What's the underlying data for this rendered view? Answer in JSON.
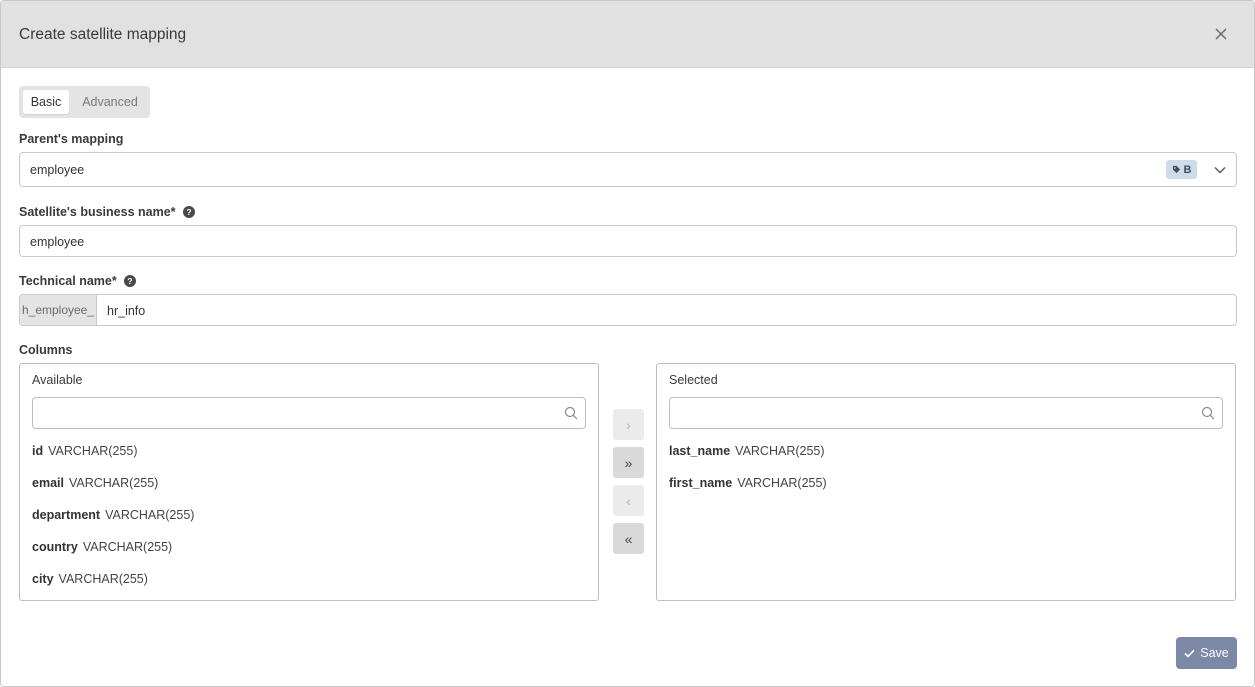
{
  "dialog": {
    "title": "Create satellite mapping"
  },
  "tabs": [
    {
      "label": "Basic",
      "active": true
    },
    {
      "label": "Advanced",
      "active": false
    }
  ],
  "parent_mapping": {
    "label": "Parent's mapping",
    "value": "employee",
    "badge": "B",
    "badge_icon": "tag-icon"
  },
  "business_name": {
    "label": "Satellite's business name*",
    "value": "employee"
  },
  "technical_name": {
    "label": "Technical name*",
    "prefix": "h_employee_",
    "value": "hr_info"
  },
  "columns": {
    "label": "Columns",
    "available": {
      "title": "Available",
      "search_placeholder": "",
      "items": [
        {
          "name": "id",
          "type": "VARCHAR(255)"
        },
        {
          "name": "email",
          "type": "VARCHAR(255)"
        },
        {
          "name": "department",
          "type": "VARCHAR(255)"
        },
        {
          "name": "country",
          "type": "VARCHAR(255)"
        },
        {
          "name": "city",
          "type": "VARCHAR(255)"
        }
      ]
    },
    "selected": {
      "title": "Selected",
      "search_placeholder": "",
      "items": [
        {
          "name": "last_name",
          "type": "VARCHAR(255)"
        },
        {
          "name": "first_name",
          "type": "VARCHAR(255)"
        }
      ]
    },
    "move_buttons": {
      "move_right": "›",
      "move_all_right": "»",
      "move_left": "‹",
      "move_all_left": "«"
    }
  },
  "footer": {
    "save_label": "Save"
  },
  "colors": {
    "header_bg": "#e1e1e1",
    "save_bg": "#7b89a6",
    "badge_bg": "#cfdbe6"
  }
}
